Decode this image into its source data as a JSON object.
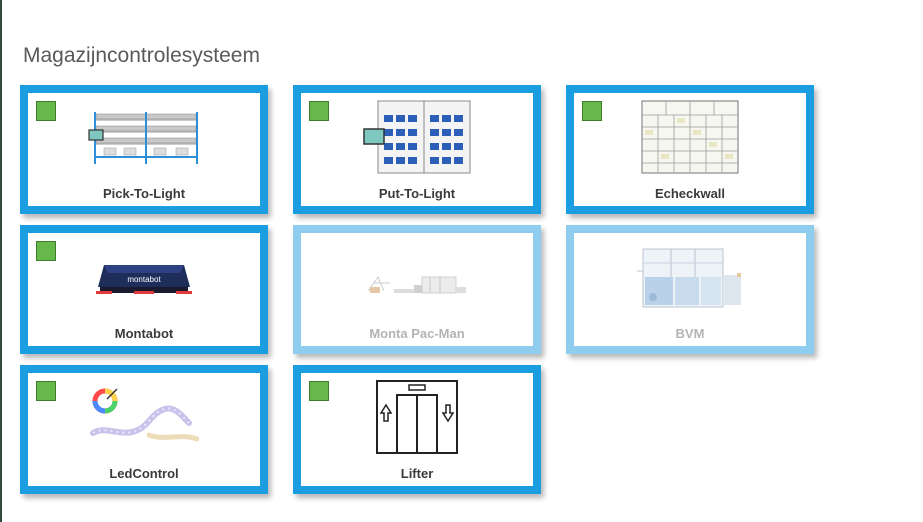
{
  "page": {
    "title": "Magazijncontrolesysteem"
  },
  "colors": {
    "tile_border": "#1a9ee0",
    "tile_border_disabled": "#8fcdee",
    "status_active": "#67b84a",
    "title_text": "#5a5a5a"
  },
  "tiles": [
    {
      "label": "Pick-To-Light",
      "icon": "pick-to-light-shelving-icon",
      "status": "active",
      "enabled": true
    },
    {
      "label": "Put-To-Light",
      "icon": "put-to-light-bins-icon",
      "status": "active",
      "enabled": true
    },
    {
      "label": "Echeckwall",
      "icon": "echeckwall-grid-icon",
      "status": "active",
      "enabled": true
    },
    {
      "label": "Montabot",
      "icon": "montabot-robot-icon",
      "status": "active",
      "enabled": true
    },
    {
      "label": "Monta Pac-Man",
      "icon": "pac-man-conveyor-icon",
      "status": "none",
      "enabled": false
    },
    {
      "label": "BVM",
      "icon": "bvm-machine-icon",
      "status": "none",
      "enabled": false
    },
    {
      "label": "LedControl",
      "icon": "led-strip-icon",
      "status": "active",
      "enabled": true
    },
    {
      "label": "Lifter",
      "icon": "elevator-icon",
      "status": "active",
      "enabled": true
    }
  ],
  "montabot_logo_text": "montabot"
}
